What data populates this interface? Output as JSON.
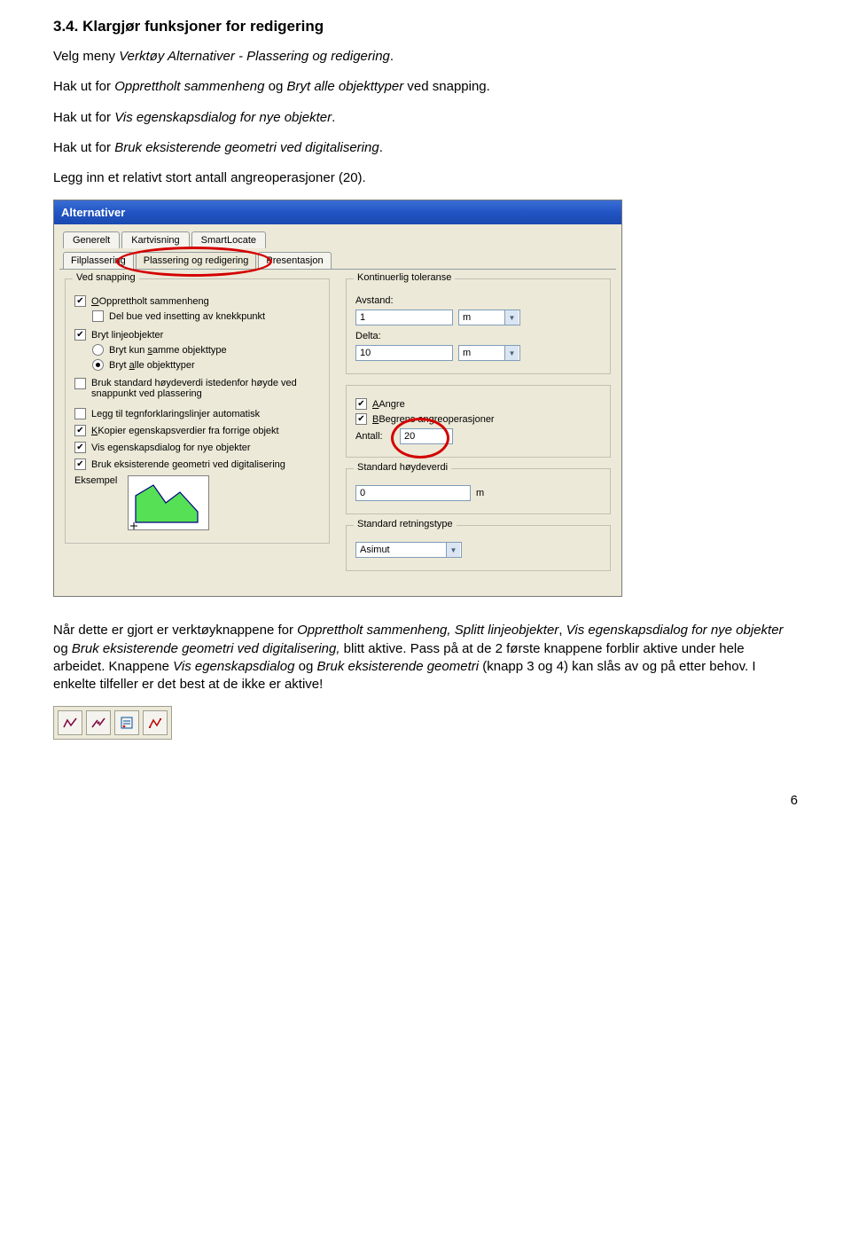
{
  "heading": "3.4. Klargjør funksjoner for redigering",
  "intro1_a": "Velg meny ",
  "intro1_b": "Verktøy Alternativer - Plassering og redigering",
  "intro1_c": ".",
  "intro2_a": "Hak ut for ",
  "intro2_b": "Opprettholt sammenheng",
  "intro2_c": " og ",
  "intro2_d": "Bryt alle objekttyper",
  "intro2_e": " ved snapping.",
  "intro3_a": "Hak ut for ",
  "intro3_b": "Vis egenskapsdialog for nye objekter",
  "intro3_c": ".",
  "intro4_a": "Hak ut for ",
  "intro4_b": "Bruk eksisterende geometri ved digitalisering",
  "intro4_c": ".",
  "intro5": "Legg inn et relativt stort antall angreoperasjoner (20).",
  "dialog": {
    "title": "Alternativer",
    "tabs": [
      "Generelt",
      "Kartvisning",
      "SmartLocate"
    ],
    "subtabs": [
      "Filplassering",
      "Plassering og redigering",
      "Presentasjon"
    ],
    "left": {
      "group": "Ved snapping",
      "cb1": "Opprettholt sammenheng",
      "cb1sub": "Del bue ved insetting av knekkpunkt",
      "cb2": "Bryt linjeobjekter",
      "rb1": "Bryt kun samme objekttype",
      "rb2": "Bryt alle objekttyper",
      "cb3": "Bruk standard høydeverdi istedenfor høyde ved snappunkt ved plassering",
      "cb4": "Legg til tegnforklaringslinjer automatisk",
      "cb5": "Kopier egenskapsverdier fra forrige objekt",
      "cb6": "Vis egenskapsdialog for nye objekter",
      "cb7": "Bruk eksisterende geometri ved digitalisering",
      "example": "Eksempel"
    },
    "right": {
      "tolGroup": "Kontinuerlig toleranse",
      "avstand": "Avstand:",
      "avstand_val": "1",
      "avstand_unit": "m",
      "delta": "Delta:",
      "delta_val": "10",
      "delta_unit": "m",
      "angre": "Angre",
      "begrens": "Begrens angreoperasjoner",
      "antall": "Antall:",
      "antall_val": "20",
      "hGroup": "Standard høydeverdi",
      "h_val": "0",
      "h_unit": "m",
      "rGroup": "Standard retningstype",
      "r_val": "Asimut"
    }
  },
  "outro1_a": "Når dette er gjort er verktøyknappene for ",
  "outro1_b": "Opprettholt sammenheng, Splitt linjeobjekter",
  "outro1_c": ", ",
  "outro1_d": "Vis egenskapsdialog for nye objekter",
  "outro1_e": " og ",
  "outro1_f": "Bruk eksisterende geometri ved digitalisering,",
  "outro1_g": " blitt aktive. Pass på at de 2 første knappene forblir aktive under hele arbeidet. Knappene ",
  "outro1_h": "Vis egenskapsdialog",
  "outro1_i": " og ",
  "outro1_j": "Bruk eksisterende geometri",
  "outro1_k": " (knapp 3 og 4) kan slås av og på etter behov. I enkelte tilfeller er det best at de ikke er aktive!",
  "page_number": "6"
}
